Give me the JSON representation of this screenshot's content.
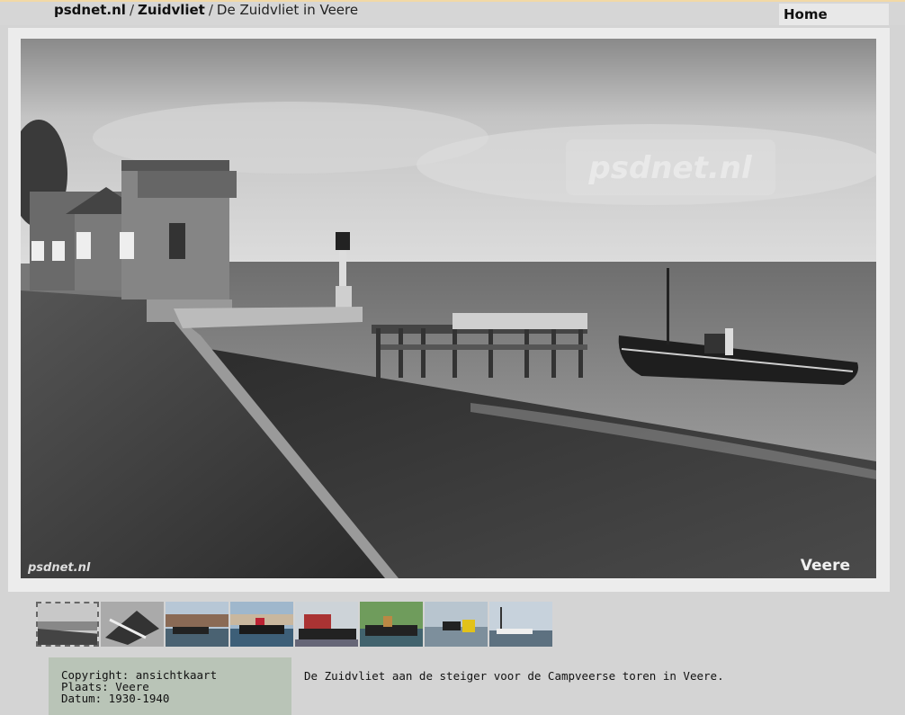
{
  "breadcrumb": {
    "site": "psdnet.nl",
    "section": "Zuidvliet",
    "current": "De Zuidvliet in Veere",
    "separator": "/"
  },
  "nav": {
    "home_label": "Home"
  },
  "photo": {
    "watermark_center": "psdnet.nl",
    "watermark_corner": "psdnet.nl",
    "place_label": "Veere"
  },
  "thumbnails": [
    {
      "active": true
    },
    {
      "active": false
    },
    {
      "active": false
    },
    {
      "active": false
    },
    {
      "active": false
    },
    {
      "active": false
    },
    {
      "active": false
    },
    {
      "active": false
    }
  ],
  "meta": {
    "copyright": "Copyright: ansichtkaart",
    "place": "Plaats: Veere",
    "date": "Datum: 1930-1940"
  },
  "caption": "De Zuidvliet aan de steiger voor de Campveerse toren in Veere."
}
